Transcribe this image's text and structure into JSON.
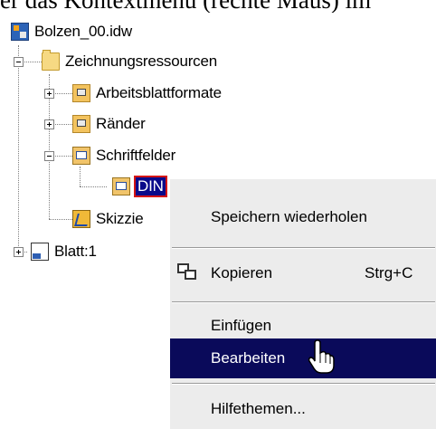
{
  "header_text": "er das Kontextmenü (rechte Maus) im",
  "tree": {
    "nodes": [
      {
        "label": "Bolzen_00.idw",
        "icon": "drawing-document-icon"
      },
      {
        "label": "Zeichnungsressourcen",
        "icon": "folder-icon"
      },
      {
        "label": "Arbeitsblattformate",
        "icon": "resource-folder-icon"
      },
      {
        "label": "Ränder",
        "icon": "resource-folder-icon"
      },
      {
        "label": "Schriftfelder",
        "icon": "resource-folder-icon"
      },
      {
        "label": "DIN",
        "icon": "title-block-icon",
        "selected": true
      },
      {
        "label": "Skizzie",
        "icon": "sketch-symbol-icon"
      },
      {
        "label": "Blatt:1",
        "icon": "sheet-icon"
      }
    ]
  },
  "context_menu": {
    "items": [
      {
        "label": "Speichern wiederholen",
        "shortcut": "",
        "icon": ""
      },
      {
        "label": "Kopieren",
        "shortcut": "Strg+C",
        "icon": "copy-icon"
      },
      {
        "label": "Einfügen",
        "shortcut": "",
        "icon": ""
      },
      {
        "label": "Bearbeiten",
        "shortcut": "",
        "icon": "",
        "highlighted": true
      },
      {
        "label": "Hilfethemen...",
        "shortcut": "",
        "icon": ""
      }
    ]
  },
  "colors": {
    "highlight_bg": "#0a0a5a",
    "highlight_text": "#ffffff",
    "selection_outline": "#d41515",
    "menu_bg": "#ececec"
  }
}
